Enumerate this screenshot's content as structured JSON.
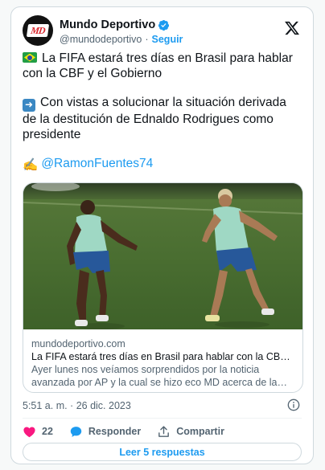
{
  "header": {
    "avatar_initials": "MD",
    "name": "Mundo Deportivo",
    "handle": "@mundodeportivo",
    "separator": "·",
    "follow_label": "Seguir",
    "verified_icon": "verified-badge-icon",
    "platform_icon": "x-logo-icon"
  },
  "tweet": {
    "line1": "La FIFA estará tres días en Brasil para hablar con la CBF y el Gobierno",
    "line2": "Con vistas a solucionar la situación derivada de la destitución de Ednaldo Rodrigues como presidente",
    "emoji3": "✍️",
    "mention": "@RamonFuentes74"
  },
  "link_card": {
    "domain": "mundodeportivo.com",
    "headline": "La FIFA estará tres días en Brasil para hablar con la CBF y el Gobierno",
    "description": "Ayer lunes nos veíamos sorprendidos por la noticia avanzada por AP y la cual se hizo eco MD acerca de la amenaza de la FIFA sobre"
  },
  "timestamp": "5:51 a. m. · 26 dic. 2023",
  "actions": {
    "likes_count": "22",
    "reply_label": "Responder",
    "share_label": "Compartir"
  },
  "read_replies_label": "Leer 5 respuestas",
  "colors": {
    "accent": "#1d9bf0",
    "like": "#f91880",
    "brand_red": "#d8232a"
  }
}
